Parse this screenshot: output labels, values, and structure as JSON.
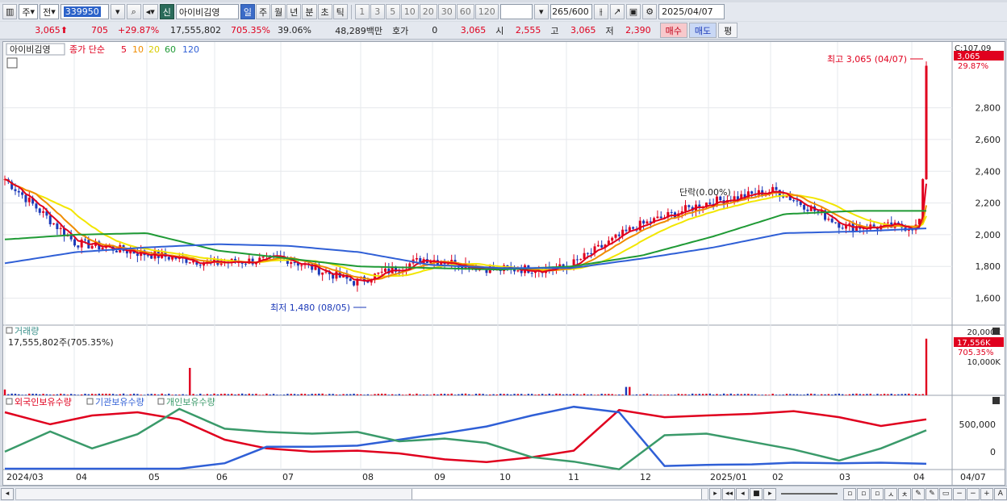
{
  "toolbar": {
    "market": "주",
    "market_type": "전",
    "code": "339950",
    "stock_type_badge": "신",
    "stock_name": "아이비김영",
    "periods": [
      "일",
      "주",
      "월",
      "년",
      "분",
      "초",
      "틱"
    ],
    "active_period": "일",
    "intervals": [
      "1",
      "3",
      "5",
      "10",
      "20",
      "30",
      "60",
      "120"
    ],
    "count_value": "265",
    "count_total": "/600",
    "date": "2025/04/07"
  },
  "quote": {
    "price": "3,065",
    "change": "705",
    "change_pct": "+29.87%",
    "volume": "17,555,802",
    "volume_ratio": "705.35%",
    "turnover": "39.06%",
    "amount": "48,289백만",
    "hoga_label": "호가",
    "hoga_value": "0",
    "hoga_price": "3,065",
    "open_label": "시",
    "open": "2,555",
    "high_label": "고",
    "high": "3,065",
    "low_label": "저",
    "low": "2,390",
    "buy_button": "매수",
    "sell_button": "매도",
    "eval_button": "평"
  },
  "colors": {
    "up": "#e0001e",
    "down": "#1b39b8",
    "ma5": "#e0001e",
    "ma10": "#f08c00",
    "ma20": "#f2e600",
    "ma60": "#1f9a35",
    "ma120": "#2f5fd6",
    "foreign": "#e0001e",
    "institution": "#2f5fd6",
    "individual": "#3a9a6a",
    "volume_bar": "#1b39b8"
  },
  "chart": {
    "legend_name": "아이비김영",
    "legend_ma_label": "종가 단순",
    "legend_ma_periods": [
      "5",
      "10",
      "20",
      "60",
      "120"
    ],
    "corner_label": "C:107.09",
    "price_tag": "3,065",
    "pct_tag": "29.87%",
    "high_marker": "최고 3,065 (04/07)",
    "low_marker": "최저 1,480 (08/05)",
    "annotation": "단락(0.00%)",
    "price_axis": [
      "2,800",
      "2,600",
      "2,400",
      "2,200",
      "2,000",
      "1,800",
      "1,600"
    ],
    "volume_title": "거래량",
    "volume_value": "17,555,802주(705.35%)",
    "volume_axis": [
      "20,000K",
      "10,000K"
    ],
    "volume_tag": "17,556K",
    "volume_pct_tag": "705.35%",
    "investor_legend": [
      "외국인보유수량",
      "기관보유수량",
      "개인보유수량"
    ],
    "investor_axis": [
      "500,000",
      "0"
    ],
    "date_axis": [
      "2024/03",
      "04",
      "05",
      "06",
      "07",
      "08",
      "09",
      "10",
      "11",
      "12",
      "2025/01",
      "02",
      "03",
      "04"
    ],
    "date_axis_right": "04/07"
  },
  "chart_data": {
    "type": "line",
    "title": "아이비김영",
    "ylim": [
      1400,
      3100
    ],
    "x": [
      "2024-03",
      "2024-04",
      "2024-05",
      "2024-06",
      "2024-07",
      "2024-08",
      "2024-09",
      "2024-10",
      "2024-11",
      "2024-12",
      "2025-01",
      "2025-02",
      "2025-03",
      "2025-04"
    ],
    "series": [
      {
        "name": "5",
        "values": [
          2350,
          1950,
          1880,
          1820,
          1850,
          1700,
          1850,
          1780,
          1790,
          2050,
          2200,
          2280,
          2050,
          3065
        ]
      },
      {
        "name": "60",
        "values": [
          1970,
          2000,
          2010,
          1900,
          1850,
          1800,
          1790,
          1780,
          1800,
          1870,
          1990,
          2130,
          2150,
          2150
        ]
      },
      {
        "name": "120",
        "values": [
          1820,
          1890,
          1920,
          1940,
          1930,
          1890,
          1810,
          1790,
          1790,
          1850,
          1920,
          2010,
          2020,
          2040
        ]
      }
    ],
    "high": {
      "label": "최고",
      "value": 3065,
      "date": "04/07"
    },
    "low": {
      "label": "최저",
      "value": 1480,
      "date": "08/05"
    }
  }
}
